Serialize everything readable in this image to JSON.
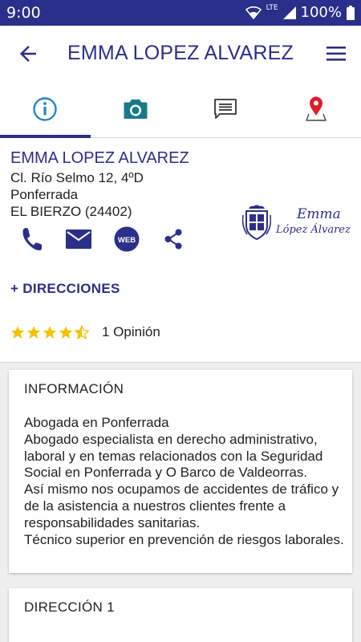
{
  "status": {
    "time": "9:00",
    "network": "LTE",
    "battery": "100%"
  },
  "header": {
    "title": "EMMA LOPEZ ALVAREZ"
  },
  "tabs": [
    {
      "icon": "info-icon",
      "active": true
    },
    {
      "icon": "camera-icon",
      "active": false
    },
    {
      "icon": "message-icon",
      "active": false
    },
    {
      "icon": "map-pin-icon",
      "active": false
    }
  ],
  "contact": {
    "name": "EMMA LOPEZ ALVAREZ",
    "address_line1": "Cl. Río Selmo 12, 4ºD",
    "address_line2": "Ponferrada",
    "address_line3": "EL BIERZO (24402)",
    "web_label": "WEB",
    "directions_link": "+ DIRECCIONES",
    "rating_value": 4.5,
    "rating_text": "1 Opinión",
    "logo_line1": "Emma",
    "logo_line2": "López Álvarez"
  },
  "info_card": {
    "title": "INFORMACIÓN",
    "lines": [
      "Abogada en Ponferrada",
      "Abogado especialista en derecho administrativo, laboral y en temas relacionados con la Seguridad Social en Ponferrada y O Barco de Valdeorras.",
      "Así mismo nos ocupamos de accidentes de tráfico y de la asistencia a nuestros clientes frente a responsabilidades sanitarias.",
      "Técnico superior en prevención de riesgos laborales."
    ]
  },
  "address_card": {
    "title": "DIRECCIÓN 1"
  },
  "colors": {
    "primary": "#2a2f8a",
    "accent": "#1e88c8",
    "teal": "#1a7a8a",
    "star": "#f6c000",
    "pin": "#e01e2b"
  }
}
